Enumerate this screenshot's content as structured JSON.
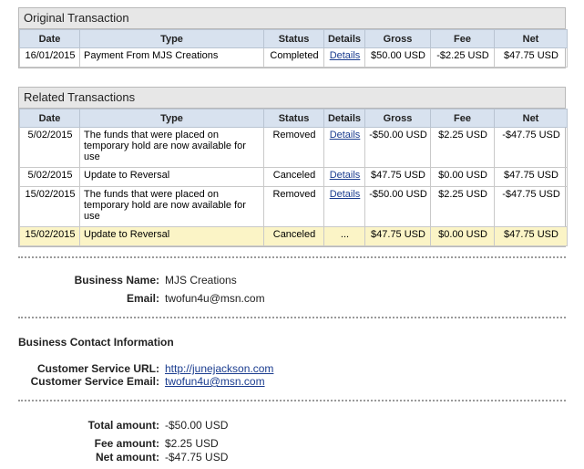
{
  "original": {
    "title": "Original Transaction",
    "headers": [
      "Date",
      "Type",
      "Status",
      "Details",
      "Gross",
      "Fee",
      "Net"
    ],
    "rows": [
      {
        "date": "16/01/2015",
        "type": "Payment From MJS Creations",
        "status": "Completed",
        "details": "Details",
        "gross": "$50.00 USD",
        "fee": "-$2.25 USD",
        "net": "$47.75 USD"
      }
    ]
  },
  "related": {
    "title": "Related Transactions",
    "headers": [
      "Date",
      "Type",
      "Status",
      "Details",
      "Gross",
      "Fee",
      "Net"
    ],
    "rows": [
      {
        "date": "5/02/2015",
        "type": "The funds that were placed on temporary hold are now available for use",
        "status": "Removed",
        "details": "Details",
        "gross": "-$50.00 USD",
        "fee": "$2.25 USD",
        "net": "-$47.75 USD"
      },
      {
        "date": "5/02/2015",
        "type": "Update to Reversal",
        "status": "Canceled",
        "details": "Details",
        "gross": "$47.75 USD",
        "fee": "$0.00 USD",
        "net": "$47.75 USD"
      },
      {
        "date": "15/02/2015",
        "type": "The funds that were placed on temporary hold are now available for use",
        "status": "Removed",
        "details": "Details",
        "gross": "-$50.00 USD",
        "fee": "$2.25 USD",
        "net": "-$47.75 USD"
      },
      {
        "date": "15/02/2015",
        "type": "Update to Reversal",
        "status": "Canceled",
        "details": "...",
        "gross": "$47.75 USD",
        "fee": "$0.00 USD",
        "net": "$47.75 USD"
      }
    ]
  },
  "business": {
    "name_label": "Business Name:",
    "name_value": "MJS Creations",
    "email_label": "Email:",
    "email_value": "twofun4u@msn.com"
  },
  "contact": {
    "heading": "Business Contact Information",
    "url_label": "Customer Service URL:",
    "url_value": "http://junejackson.com",
    "email_label": "Customer Service Email:",
    "email_value": "twofun4u@msn.com"
  },
  "totals": {
    "total_label": "Total amount:",
    "total_value": "-$50.00 USD",
    "fee_label": "Fee amount:",
    "fee_value": "$2.25 USD",
    "net_label": "Net amount:",
    "net_value": "-$47.75 USD"
  },
  "colors": {
    "header_bg": "#d8e2ef",
    "panel_title_bg": "#e7e7e7",
    "highlight_row": "#fbf4c6",
    "link": "#1a3c8f"
  }
}
